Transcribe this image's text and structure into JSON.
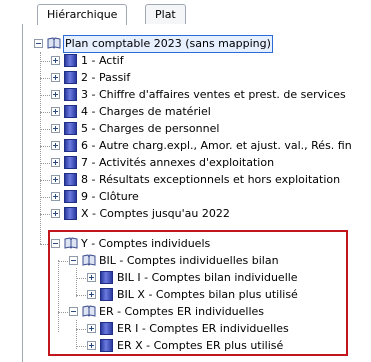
{
  "tabs": {
    "hierarchical": "Hiérarchique",
    "flat": "Plat"
  },
  "tree": {
    "root": "Plan comptable 2023 (sans mapping)",
    "items": [
      "1 - Actif",
      "2 - Passif",
      "3 - Chiffre d'affaires ventes et prest. de services",
      "4 - Charges de matériel",
      "5 - Charges de personnel",
      "6 - Autre charg.expl., Amor. et ajust. val., Rés. fin",
      "7 - Activités annexes d'exploitation",
      "8 - Résultats exceptionnels et hors exploitation",
      "9 - Clôture",
      "X - Comptes jusqu'au 2022"
    ],
    "y_node": "Y - Comptes individuels",
    "bil_node": "BIL - Comptes individuelles bilan",
    "bil_items": [
      "BIL I - Comptes bilan individuelle",
      "BIL X - Comptes bilan plus utilisé"
    ],
    "er_node": "ER - Comptes ER individuelles",
    "er_items": [
      "ER I - Comptes ER individuelles",
      "ER X - Comptes ER plus utilisé"
    ]
  },
  "colors": {
    "highlight_box": "#c2161c",
    "book_blue": "#2a3a9e"
  }
}
